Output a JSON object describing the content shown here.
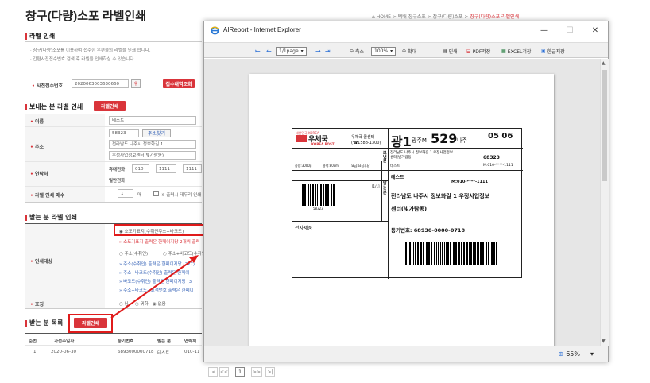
{
  "page": {
    "title": "창구(다량)소포 라벨인쇄",
    "breadcrumb": {
      "home": "HOME",
      "item1": "택배 창구소포",
      "item2": "창구(다량)소포",
      "current": "창구(다량)소포 라벨인쇄"
    }
  },
  "label_print_section": {
    "title": "라벨 인쇄",
    "note1": "· 창구(다량)소포를 이용하여 접수한 우편물의 라벨을 인쇄 합니다.",
    "note2": "· 간편사전접수번호 검색 후 라벨을 인쇄하실 수 있습니다.",
    "receipt_label": "사전접수번호",
    "receipt_value": "2020063003630660",
    "receipt_button": "접수내역조회"
  },
  "sender_section": {
    "title": "보내는 분 라벨 인쇄",
    "print_button": "라벨인쇄",
    "name_label": "이름",
    "name_value": "테스트",
    "address_label": "주소",
    "zip": "58323",
    "zip_button": "주소찾기",
    "addr1": "전라남도 나주시 정보화길 1",
    "addr2": "우정사업정보센터(빛가람동)",
    "phone_label": "연락처",
    "mobile_label": "휴대전화",
    "mobile1": "010",
    "mobile2": "1111",
    "mobile3": "1111",
    "tel_label": "일반전화",
    "count_label": "라벨 인쇄 매수",
    "count_value": "1",
    "count_unit": "매",
    "count_check": "※ 출력시 테두리 인쇄"
  },
  "receiver_section": {
    "title": "받는 분 라벨 인쇄",
    "target_label": "인쇄대상",
    "opt1": "소포기표지(수취인주소+바코드)",
    "opt1_desc": "» 소포기표지 출력은 한페이지당 2개씩 출력",
    "opt2": "주소(수취인)",
    "opt3": "주소+바코드(수취인)",
    "desc2": "» 주소(수취인) 출력은 한페이지당 (2x7)",
    "desc3": "» 주소+바코드(수취인) 출력은 한페이",
    "desc4": "» 바코드(수취인) 출력은 한페이지당 (3",
    "desc5": "» 주소+바코드+고객번호 출력은 한페이",
    "gender_label": "호칭",
    "g1": "님",
    "g2": "귀하",
    "g3": "없음"
  },
  "list_section": {
    "title": "받는 분 목록",
    "print_button": "라벨인쇄",
    "columns": [
      "순번",
      "가접수일자",
      "등기번호",
      "받는 분",
      "연락처"
    ],
    "rows": [
      {
        "no": "1",
        "date": "2020-06-30",
        "reg": "6893000000718",
        "name": "테스트",
        "tel": "010-11"
      }
    ],
    "pager": [
      "|<",
      "<<",
      "1",
      ">>",
      ">|"
    ]
  },
  "ie_window": {
    "title": "AIReport - Internet Explorer",
    "toolbar": {
      "page_select": "1/1page",
      "zoom_out": "축소",
      "zoom_select": "100%",
      "zoom_in": "확대",
      "print": "인쇄",
      "pdf": "PDF저장",
      "excel": "EXCEL저장",
      "hangul": "한글저장"
    },
    "status_zoom": "65%"
  },
  "shipping_label": {
    "brand_top": "대한민국 KOREA",
    "brand_main": "우체국",
    "brand_sub": "KOREA POST",
    "center_name": "우체국 콜센터",
    "center_phone": "(☎1588-1300)",
    "route_big": "광1",
    "route_mid": "광주M",
    "route_num": "529",
    "route_city": "나주",
    "route_code": "05 06",
    "sender_addr": "전라남도 나주시 정보화길 1 우정사업정보센터(빛가람동)",
    "sender_zip": "68323",
    "sender_name": "테스트",
    "sender_tel": "M:010-****-1111",
    "weight": "중량:3000g",
    "volume": "용적:80cm",
    "fee": "요금:요금후납",
    "side_send": "보낸분",
    "side_recv": "받는분",
    "barcode_num": "58323",
    "page_ind": "[1/1]",
    "recv_name": "테스트",
    "recv_tel": "M:010-****-1111",
    "recv_addr1": "전라남도 나주시 정보화길 1 우정사업정보",
    "recv_addr2": "센터(빛가람동)",
    "item": "전자제품",
    "reg_no": "등기번호: 68930-0000-0718"
  }
}
